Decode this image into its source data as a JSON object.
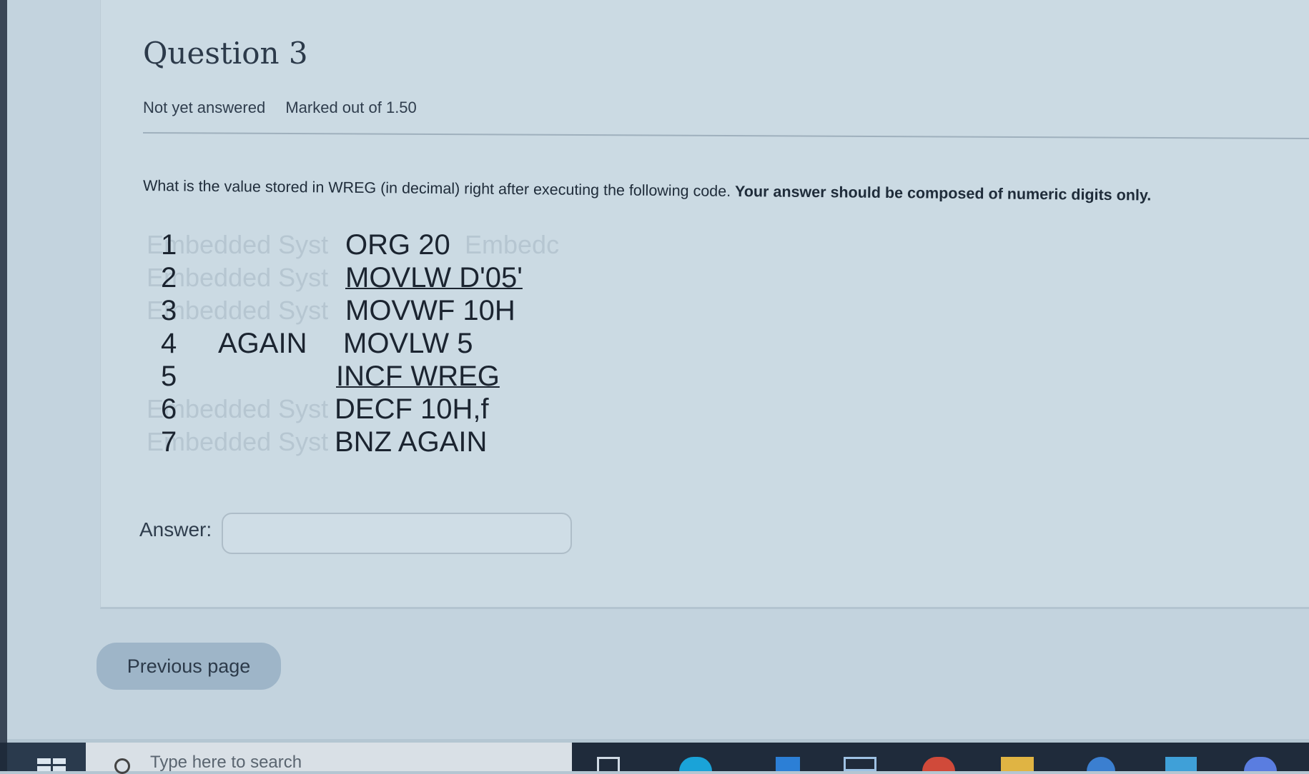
{
  "question": {
    "title": "Question 3",
    "status": "Not yet answered",
    "marks": "Marked out of 1.50",
    "prompt_normal": "What is the value stored in WREG (in decimal) right after executing the following code. ",
    "prompt_bold": "Your answer should be composed  of numeric digits only."
  },
  "code": {
    "watermark": "Embedded Syst",
    "watermark_tail": "Embedc",
    "lines": [
      {
        "num": "1",
        "label": "",
        "instr": "ORG 20"
      },
      {
        "num": "2",
        "label": "",
        "instr": "MOVLW  D'05'"
      },
      {
        "num": "3",
        "label": "",
        "instr": "MOVWF  10H"
      },
      {
        "num": "4",
        "label": "AGAIN",
        "instr": "MOVLW 5"
      },
      {
        "num": "5",
        "label": "",
        "instr": "INCF  WREG"
      },
      {
        "num": "6",
        "label": "",
        "instr": "DECF 10H,f"
      },
      {
        "num": "7",
        "label": "",
        "instr": "BNZ   AGAIN"
      }
    ]
  },
  "answer": {
    "label": "Answer:",
    "value": ""
  },
  "navigation": {
    "previous": "Previous page"
  },
  "taskbar": {
    "search_placeholder": "Type here to search",
    "icons": [
      "task-view-icon",
      "edge-icon",
      "file-explorer-icon",
      "mail-icon",
      "chrome-icon",
      "folder-icon",
      "store-icon",
      "settings-icon"
    ]
  },
  "colors": {
    "page_bg": "#c3d3de",
    "button_bg": "#9eb5c8",
    "taskbar_bg": "#1f2b3b"
  }
}
